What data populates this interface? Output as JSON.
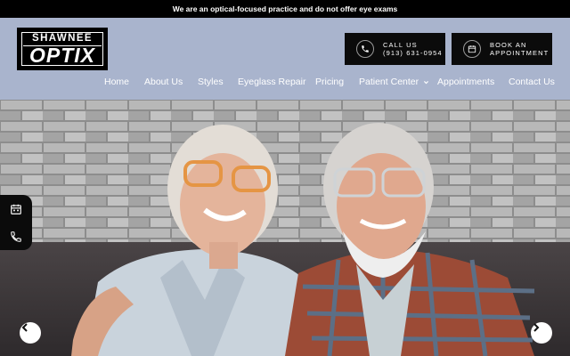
{
  "announcement": "We are an optical-focused practice and do not offer eye exams",
  "logo": {
    "line1": "SHAWNEE",
    "line2": "OPTIX"
  },
  "cta": {
    "call": {
      "line1": "CALL US",
      "line2": "(913) 631-0954",
      "icon": "phone-icon"
    },
    "book": {
      "line1": "BOOK AN",
      "line2": "APPOINTMENT",
      "icon": "calendar-icon"
    }
  },
  "nav": [
    "Home",
    "About Us",
    "Styles",
    "Eyeglass Repair",
    "Pricing",
    "Patient Center",
    "Appointments",
    "Contact Us"
  ],
  "nav_dropdown_icon": "chevron-down-icon",
  "hero": {
    "description_icon": "hero-photo",
    "prev_icon": "chevron-left-icon",
    "next_icon": "chevron-right-icon"
  },
  "side_tabs": [
    "calendar-icon",
    "phone-icon"
  ],
  "colors": {
    "header_bg": "#a9b4cd",
    "topbar_bg": "#000000",
    "cta_bg": "#0b0b0b",
    "nav_text": "#ffffff"
  }
}
